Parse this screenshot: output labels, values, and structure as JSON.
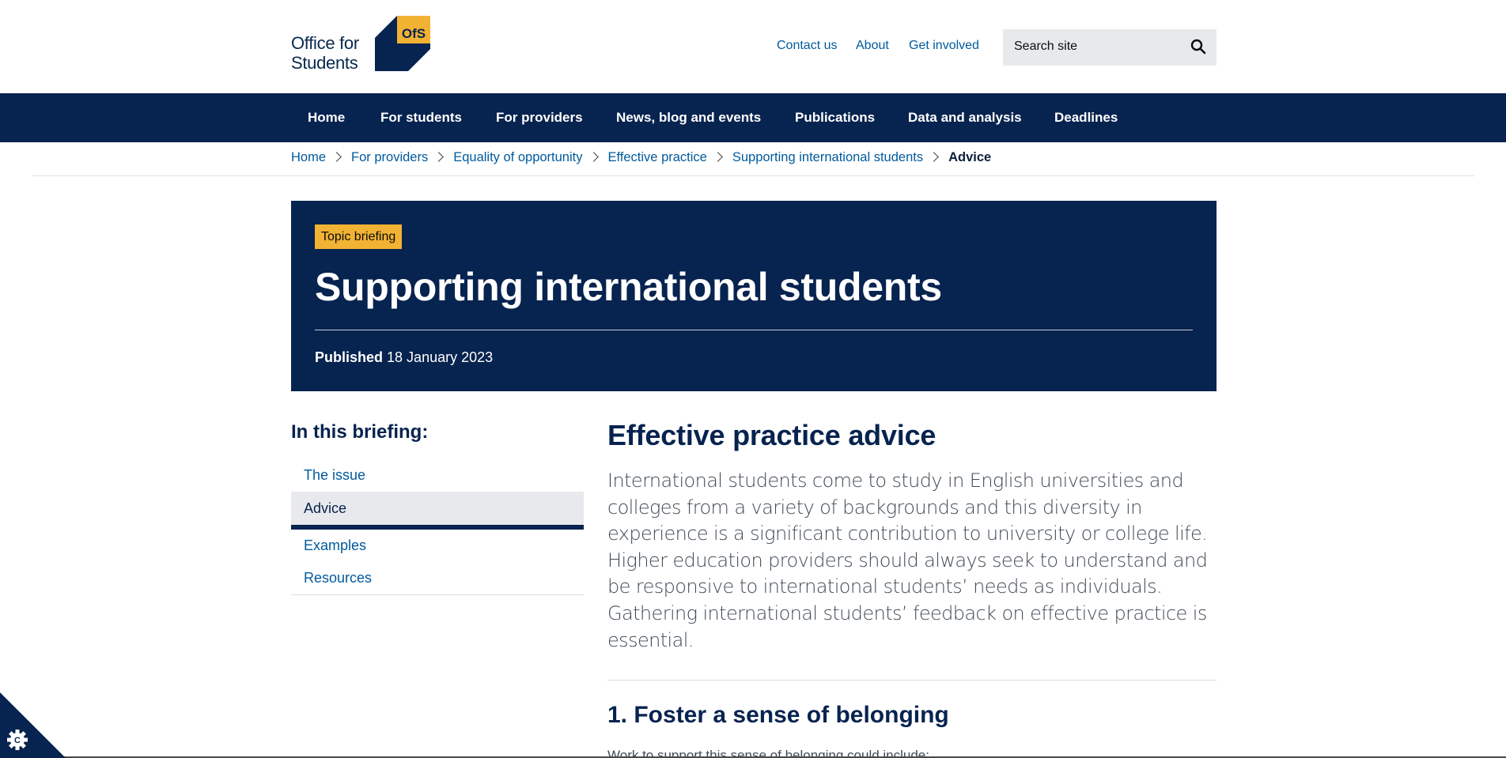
{
  "brand": {
    "logo_line1": "Office for",
    "logo_line2": "Students",
    "logo_mark_text": "OfS",
    "colors": {
      "navy": "#07234f",
      "yellow": "#f2b233",
      "link": "#005a9c"
    }
  },
  "utility_nav": [
    {
      "label": "Contact us"
    },
    {
      "label": "About"
    },
    {
      "label": "Get involved"
    }
  ],
  "search": {
    "placeholder": "Search site",
    "icon": "search-icon"
  },
  "main_nav": [
    {
      "label": "Home"
    },
    {
      "label": "For students"
    },
    {
      "label": "For providers"
    },
    {
      "label": "News, blog and events"
    },
    {
      "label": "Publications"
    },
    {
      "label": "Data and analysis"
    },
    {
      "label": "Deadlines"
    }
  ],
  "breadcrumb": {
    "items": [
      "Home",
      "For providers",
      "Equality of opportunity",
      "Effective practice",
      "Supporting international students"
    ],
    "current": "Advice"
  },
  "hero": {
    "badge": "Topic briefing",
    "title": "Supporting international students",
    "published_label": "Published",
    "published_date": "18 January 2023"
  },
  "sidebar": {
    "heading": "In this briefing:",
    "items": [
      {
        "label": "The issue"
      },
      {
        "label": "Advice",
        "active": true
      },
      {
        "label": "Examples"
      },
      {
        "label": "Resources"
      }
    ]
  },
  "main": {
    "heading": "Effective practice advice",
    "lead": "International students come to study in English universities and colleges from a variety of backgrounds and this diversity in experience is a significant contribution to university or college life. Higher education providers should always seek to understand and be responsive to international students’ needs as individuals. Gathering international students’ feedback on effective practice is essential.",
    "section_heading": "1. Foster a sense of belonging",
    "section_intro": "Work to support this sense of belonging could include:"
  },
  "cookie": {
    "icon": "cookie-settings-icon"
  }
}
